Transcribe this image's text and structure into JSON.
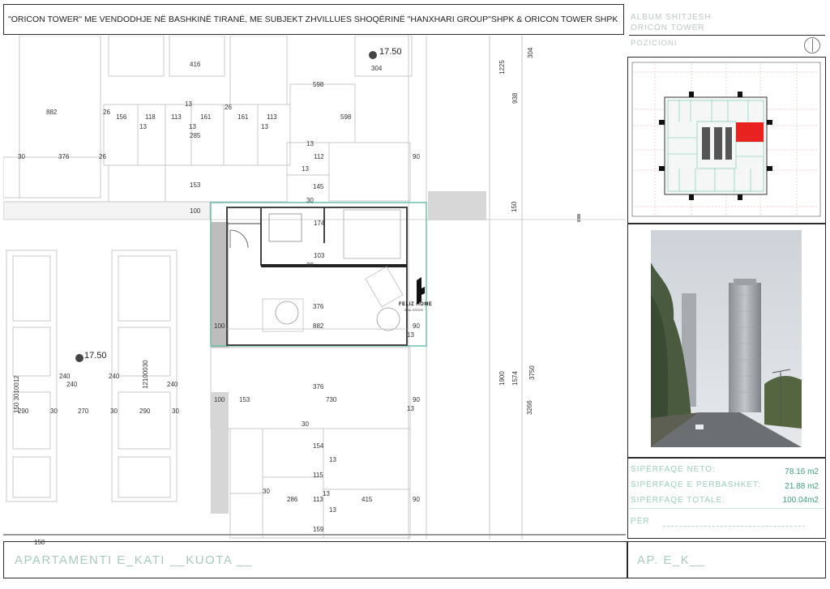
{
  "header": {
    "title": "\"ORICON TOWER\" ME VENDODHJE NË BASHKINË TIRANË, ME SUBJEKT ZHVILLUES SHOQËRINË \"HANXHARI GROUP\"SHPK & ORICON TOWER SHPK",
    "album_line1": "ALBUM SHITJESH",
    "album_line2": "ORICON TOWER",
    "position_label": "POZICIONI"
  },
  "brand": {
    "name": "FELIZ HOME",
    "tagline": "REAL ESTATE"
  },
  "floorplan": {
    "elevation_top": "17.50",
    "elevation_left": "17.50",
    "dimensions": [
      "416",
      "598",
      "598",
      "304",
      "882",
      "26",
      "156",
      "118",
      "113",
      "161",
      "161",
      "113",
      "13",
      "13",
      "13",
      "13",
      "285",
      "26",
      "30",
      "376",
      "26",
      "13",
      "112",
      "90",
      "13",
      "145",
      "153",
      "100",
      "30",
      "174",
      "103",
      "30",
      "376",
      "100",
      "882",
      "90",
      "13",
      "240",
      "240",
      "240",
      "240",
      "290",
      "30",
      "270",
      "30",
      "290",
      "30",
      "100",
      "153",
      "730",
      "90",
      "13",
      "376",
      "30",
      "154",
      "13",
      "115",
      "30",
      "286",
      "113",
      "13",
      "415",
      "90",
      "13",
      "159",
      "150",
      "1225",
      "938",
      "150",
      "1900",
      "1574",
      "3750",
      "3266",
      "304",
      "150 3010012",
      "12100030"
    ]
  },
  "areas": {
    "neto_label": "SIPËRFAQE NETO:",
    "neto_value": "78.16 m2",
    "common_label": "SIPËRFAQE E PERBASHKET:",
    "common_value": "21.88 m2",
    "total_label": "SIPËRFAQE TOTALE:",
    "total_value": "100.04m2",
    "per_label": "PËR"
  },
  "footer": {
    "apartment_label": "APARTAMENTI E_KATI __KUOTA __",
    "code_label": "AP. E_K__"
  },
  "colors": {
    "highlight": "#e8231f",
    "accent_green": "#3c9e7f",
    "plan_teal": "#6cc1ad"
  }
}
